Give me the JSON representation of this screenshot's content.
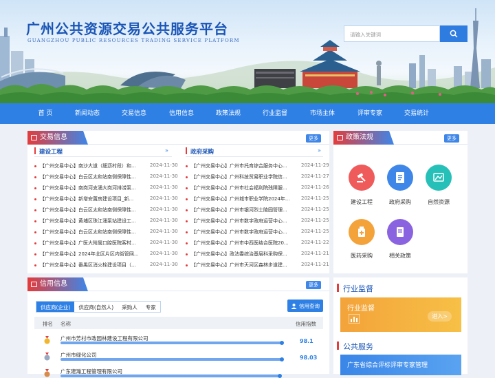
{
  "site": {
    "title": "广州公共资源交易公共服务平台",
    "subtitle": "GUANGZHOU PUBLIC RESOURCES TRADING SERVICE PLATFORM",
    "search_placeholder": "请输入关键词"
  },
  "nav": [
    "首 页",
    "新闻动态",
    "交易信息",
    "信用信息",
    "政策法规",
    "行业监督",
    "市场主体",
    "评审专家",
    "交易统计"
  ],
  "trade": {
    "title": "交易信息",
    "more": "更多",
    "left_head": "建设工程",
    "right_head": "政府采购",
    "left_items": [
      {
        "text": "【广州交易中心】南沙大道（细沥村段）和...",
        "date": "2024-11-30"
      },
      {
        "text": "【广州交易中心】白云区太和站南侧保障性...",
        "date": "2024-11-30"
      },
      {
        "text": "【广州交易中心】南岗河支涌大岗河排涝泵...",
        "date": "2024-11-30"
      },
      {
        "text": "【广州交易中心】新增安置房建设项目_新...",
        "date": "2024-11-30"
      },
      {
        "text": "【广州交易中心】白云区太和站南侧保障性...",
        "date": "2024-11-30"
      },
      {
        "text": "【广州交易中心】黄埔区珠江涌泵站建设工...",
        "date": "2024-11-30"
      },
      {
        "text": "【广州交易中心】白云区太和站南侧保障性...",
        "date": "2024-11-30"
      },
      {
        "text": "【广州交易中心】广医大附属口腔医院客村...",
        "date": "2024-11-30"
      },
      {
        "text": "【广州交易中心】2024年北区片区内街管网...",
        "date": "2024-11-30"
      },
      {
        "text": "【广州交易中心】番禺区消火栓建设项目（...",
        "date": "2024-11-30"
      }
    ],
    "right_items": [
      {
        "text": "【广州交易中心】广州市托育综合服务中心...",
        "date": "2024-11-29"
      },
      {
        "text": "【广州交易中心】广州科技贸易职业学院信...",
        "date": "2024-11-27"
      },
      {
        "text": "【广州交易中心】广州市社会福利院残障服...",
        "date": "2024-11-26"
      },
      {
        "text": "【广州交易中心】广州城市职业学院2024年...",
        "date": "2024-11-25"
      },
      {
        "text": "【广州交易中心】广州市银河烈士陵园管理...",
        "date": "2024-11-25"
      },
      {
        "text": "【广州交易中心】广州市数字政府运营中心...",
        "date": "2024-11-25"
      },
      {
        "text": "【广州交易中心】广州市数字政府运营中心...",
        "date": "2024-11-25"
      },
      {
        "text": "【广州交易中心】广州市中西医结合医院20...",
        "date": "2024-11-22"
      },
      {
        "text": "【广州交易中心】政法委综治基层科采购保...",
        "date": "2024-11-21"
      },
      {
        "text": "【广州交易中心】广州市天河区森林步道建...",
        "date": "2024-11-21"
      }
    ]
  },
  "policy": {
    "title": "政策法规",
    "more": "更多",
    "items": [
      {
        "label": "建设工程",
        "icon": "gavel-icon",
        "color": "#ef5a5a"
      },
      {
        "label": "政府采购",
        "icon": "document-icon",
        "color": "#3e86e8"
      },
      {
        "label": "自然资源",
        "icon": "leaf-icon",
        "color": "#27c0b8"
      },
      {
        "label": "医药采购",
        "icon": "medicine-icon",
        "color": "#f3a33a"
      },
      {
        "label": "相关政策",
        "icon": "book-icon",
        "color": "#8a63e0"
      }
    ]
  },
  "credit": {
    "title": "信用信息",
    "more": "更多",
    "tabs": [
      "供应商(企业)",
      "供应商(自然人)",
      "采购人",
      "专家"
    ],
    "query_button": "信用查询",
    "col_rank": "排名",
    "col_name": "名称",
    "col_index": "信用指数",
    "rows": [
      {
        "name": "广州市芳村市政园林建设工程有限公司",
        "score": "98.1",
        "pct": 0.98
      },
      {
        "name": "广州市绿化公司",
        "score": "98.03",
        "pct": 0.98
      },
      {
        "name": "广东建瀚工程管理有限公司",
        "score": "",
        "pct": 0.97
      }
    ]
  },
  "supervision": {
    "title": "行业监督",
    "box_title": "行业监督",
    "box_action": "进入>"
  },
  "service": {
    "title": "公共服务",
    "box_title": "广东省综合评标评审专家管理"
  }
}
